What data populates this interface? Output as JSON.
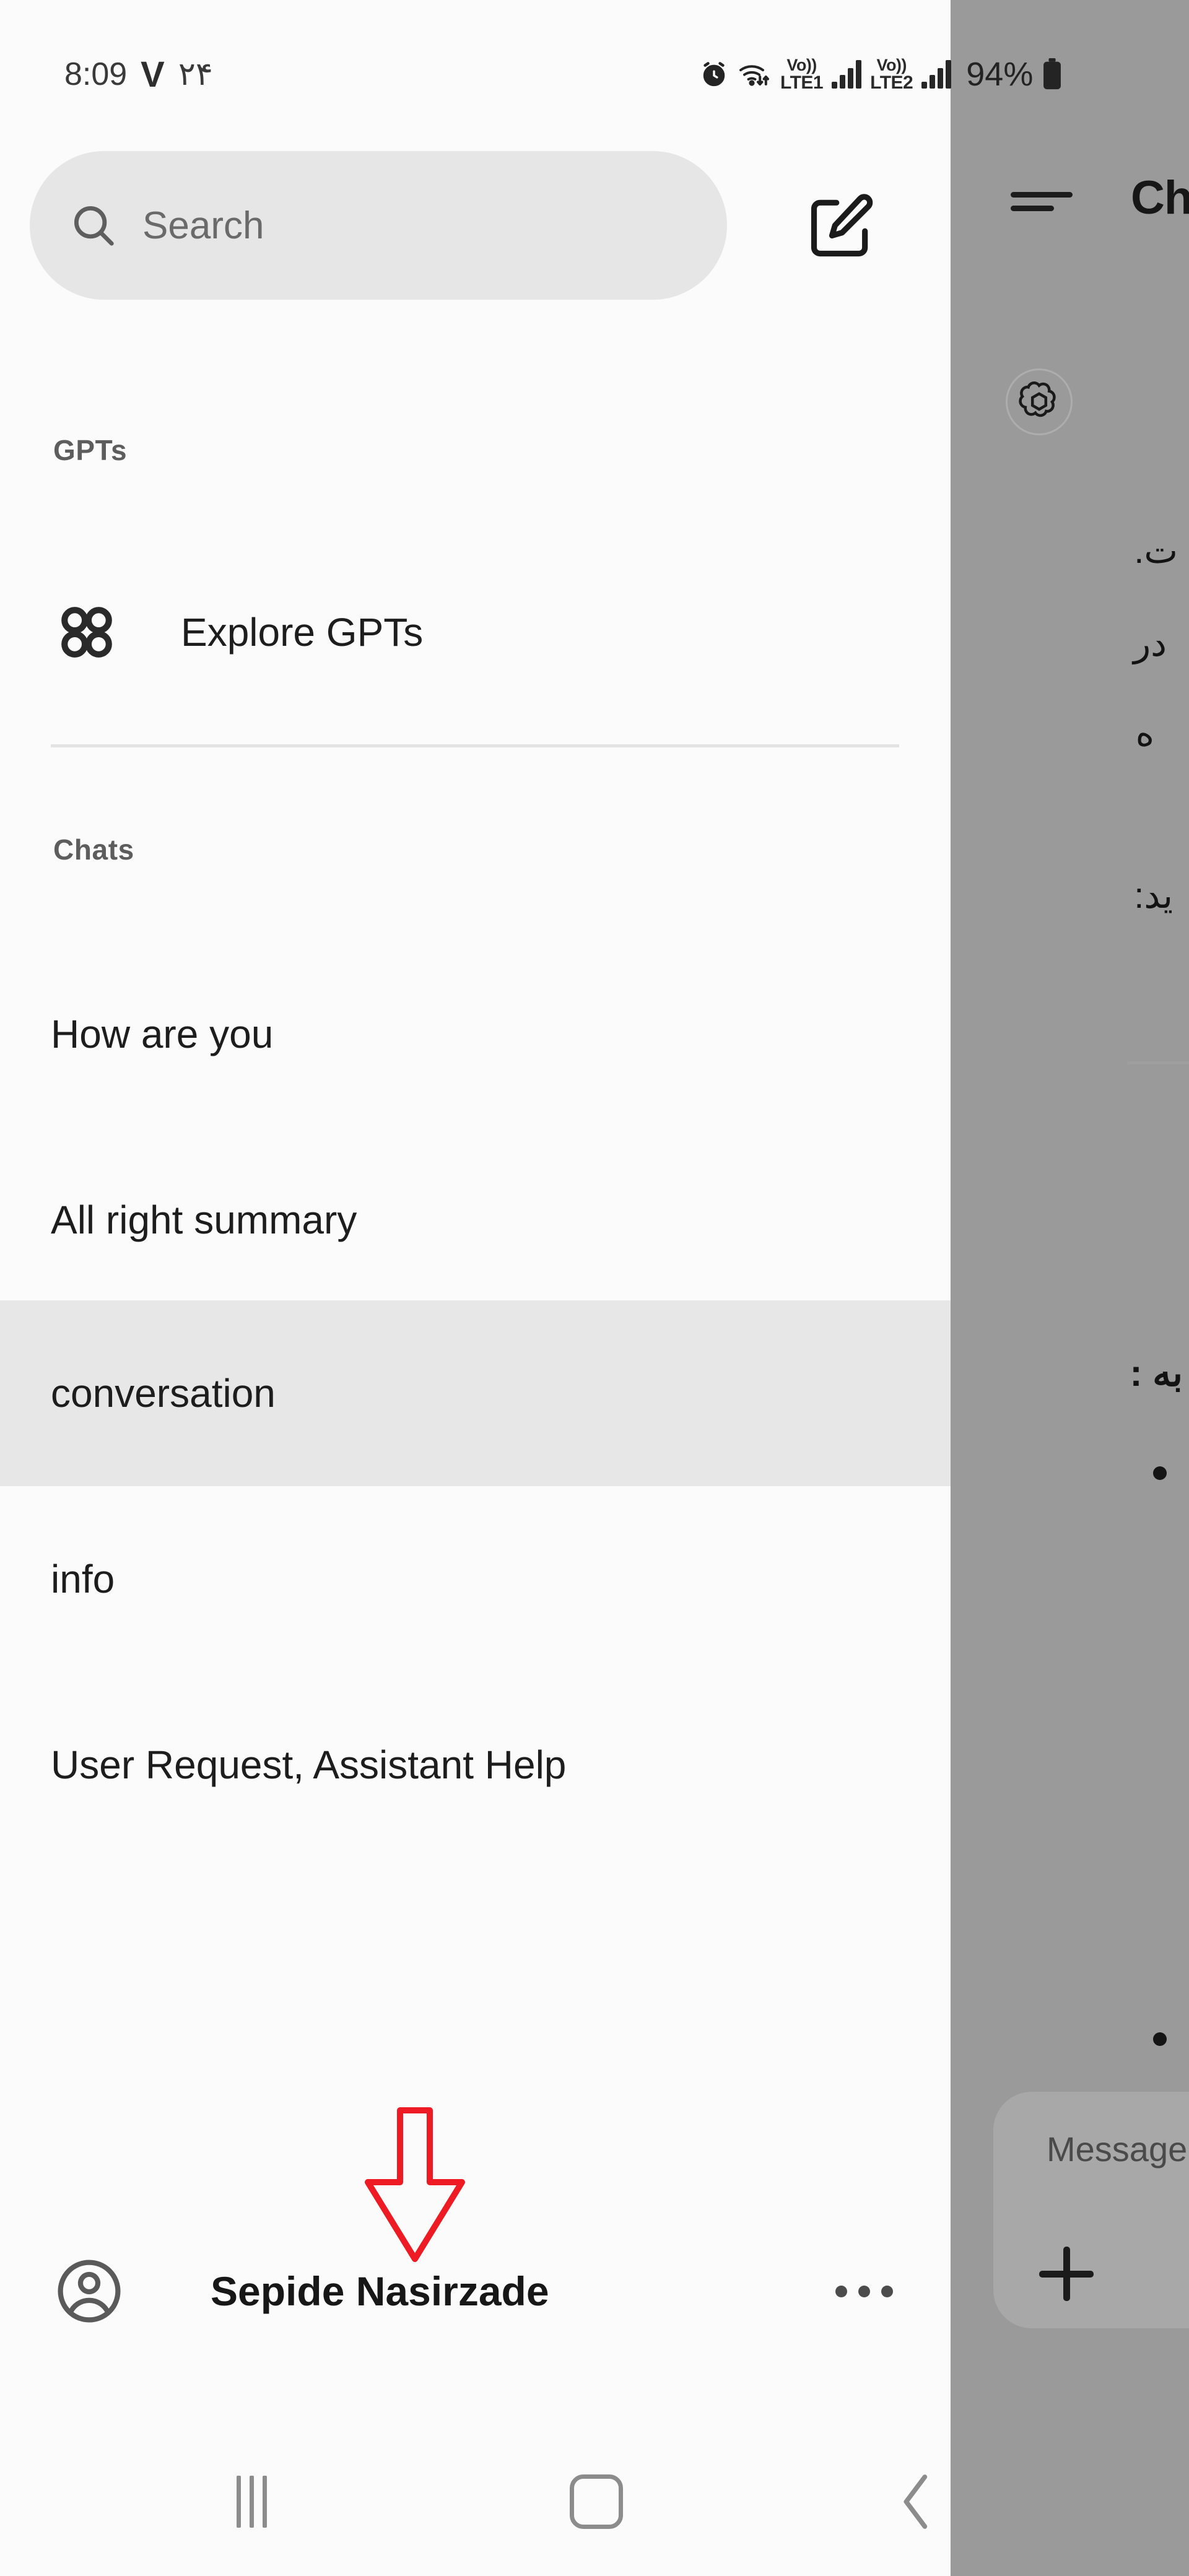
{
  "statusbar": {
    "time": "8:09",
    "vpn_glyph": "V",
    "date_persian": "۲۴",
    "alarm_icon": "alarm-clock-icon",
    "wifi_icon": "wifi-data-icon",
    "sim1_volte": "Vo))",
    "sim1_network": "LTE1",
    "sim2_volte": "Vo))",
    "sim2_network": "LTE2",
    "battery_percent": "94%",
    "battery_icon": "battery-full-icon"
  },
  "sidebar": {
    "search": {
      "placeholder": "Search",
      "icon": "search-icon"
    },
    "compose_icon": "compose-edit-icon",
    "gpts": {
      "section_label": "GPTs",
      "explore_label": "Explore GPTs",
      "explore_icon": "grid-circles-icon"
    },
    "chats": {
      "section_label": "Chats",
      "items": [
        {
          "label": "How are you",
          "active": false
        },
        {
          "label": "All right summary",
          "active": false
        },
        {
          "label": "conversation",
          "active": true
        },
        {
          "label": "info",
          "active": false
        },
        {
          "label": "User Request, Assistant Help",
          "active": false
        }
      ]
    },
    "account": {
      "name": "Sepide Nasirzade",
      "avatar_icon": "account-circle-icon",
      "more_icon": "more-horizontal-icon"
    }
  },
  "annotation": {
    "arrow_icon": "down-arrow-annotation",
    "color": "#ee1b24"
  },
  "chat_panel": {
    "menu_icon": "hamburger-menu-icon",
    "title": "ChatGPT",
    "assistant_avatar_icon": "openai-logo-icon",
    "message_lines": [
      "ت.",
      "در",
      "ه",
      "ید:"
    ],
    "bold_line": "به\n:",
    "bullets": [
      "•",
      "•"
    ],
    "composer": {
      "placeholder": "Message",
      "attach_icon": "plus-icon"
    }
  },
  "navbar": {
    "recent_icon": "recent-apps-icon",
    "home_icon": "home-icon",
    "back_icon": "back-chevron-icon"
  }
}
